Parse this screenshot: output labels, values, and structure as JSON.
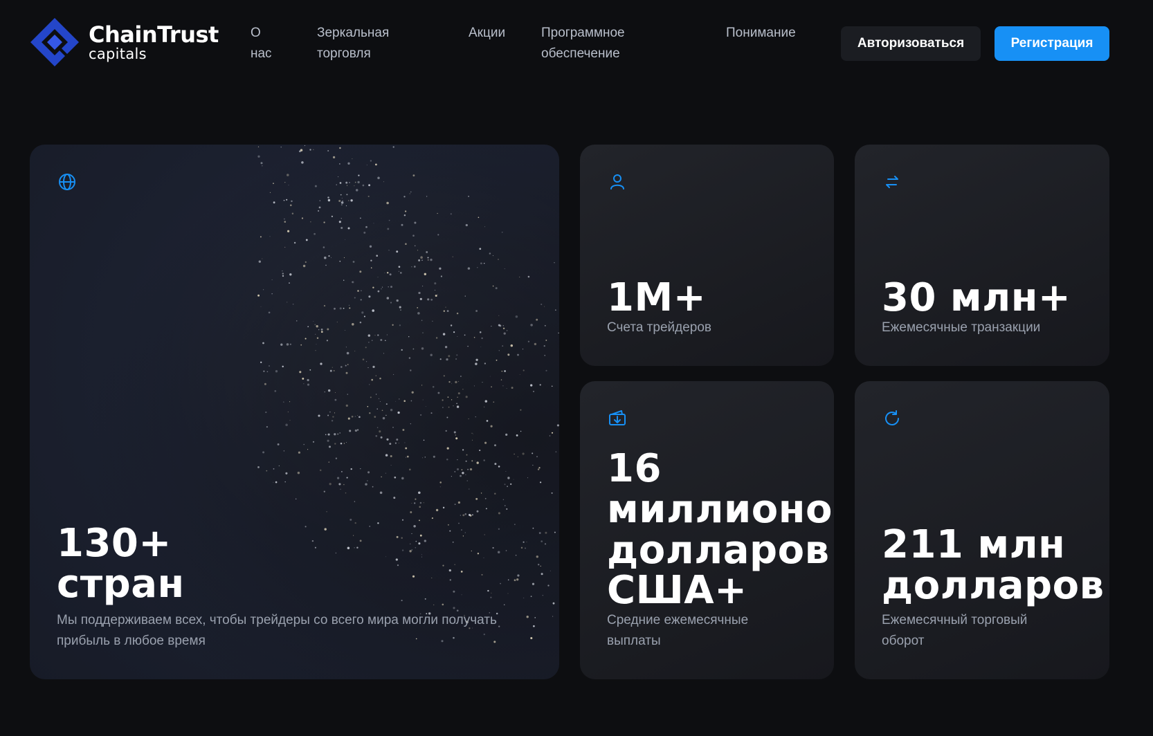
{
  "brand": {
    "title": "ChainTrust",
    "subtitle": "capitals",
    "accent": "#1790f5",
    "logo_color": "#2446c9"
  },
  "nav": {
    "about": "О нас",
    "mirror": "Зеркальная торговля",
    "promos": "Акции",
    "software": "Программное обеспечение",
    "insight": "Понимание"
  },
  "auth": {
    "login": "Авторизоваться",
    "register": "Регистрация"
  },
  "stats": {
    "countries": {
      "icon": "globe-icon",
      "value_line1": "130+",
      "value_line2": "стран",
      "caption": "Мы поддерживаем всех, чтобы трейдеры со всего мира могли получать прибыль в любое время"
    },
    "accounts": {
      "icon": "user-icon",
      "value": "1M+",
      "caption": "Счета трейдеров"
    },
    "transactions": {
      "icon": "exchange-arrows-icon",
      "value": "30 млн+",
      "caption": "Ежемесячные транзакции"
    },
    "payouts": {
      "icon": "wallet-download-icon",
      "value_line1": "16",
      "value_line2": "миллионов",
      "value_line3": "долларов",
      "value_line4": "США+",
      "caption": "Средние ежемесячные выплаты"
    },
    "turnover": {
      "icon": "refresh-icon",
      "value_line1": "211 млн",
      "value_line2": "долларов",
      "caption": "Ежемесячный торговый оборот"
    }
  }
}
